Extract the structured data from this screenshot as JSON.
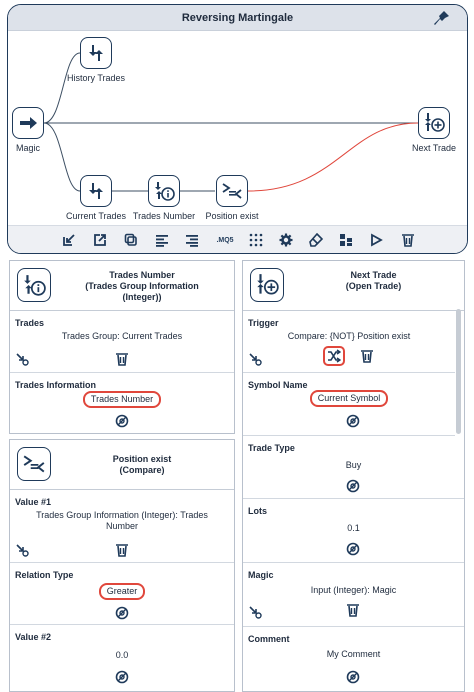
{
  "diagram": {
    "title": "Reversing Martingale",
    "nodes": [
      {
        "id": "history",
        "label": "History Trades",
        "icon": "history-trades-icon"
      },
      {
        "id": "magic",
        "label": "Magic",
        "icon": "input-arrow-icon"
      },
      {
        "id": "current",
        "label": "Current Trades",
        "icon": "current-trades-icon"
      },
      {
        "id": "number",
        "label": "Trades Number",
        "icon": "trades-info-icon"
      },
      {
        "id": "position",
        "label": "Position exist",
        "icon": "compare-icon"
      },
      {
        "id": "next",
        "label": "Next Trade",
        "icon": "open-trade-icon"
      }
    ],
    "toolbar": [
      "import-icon",
      "export-icon",
      "copy-icon",
      "align-left-icon",
      "align-right-icon",
      ".MQ5",
      "grid-icon",
      "settings-icon",
      "eraser-icon",
      "layout-icon",
      "run-icon",
      "delete-icon"
    ],
    "colors": {
      "link": "#3d4f63",
      "active_link": "#e0473c",
      "border": "#1f3a5a"
    }
  },
  "panels": {
    "trades_number": {
      "title": "Trades Number\n(Trades Group Information\n(Integer))",
      "fields": [
        {
          "label": "Trades",
          "value": "Trades Group: Current Trades"
        },
        {
          "label": "Trades Information",
          "value": "Trades Number"
        }
      ]
    },
    "position_exist": {
      "title": "Position exist\n(Compare)",
      "fields": [
        {
          "label": "Value #1",
          "value": "Trades Group Information (Integer): Trades Number"
        },
        {
          "label": "Relation Type",
          "value": "Greater"
        },
        {
          "label": "Value #2",
          "value": "0.0"
        }
      ]
    },
    "next_trade": {
      "title": "Next Trade\n(Open Trade)",
      "fields": [
        {
          "label": "Trigger",
          "value": "Compare: {NOT} Position exist"
        },
        {
          "label": "Symbol Name",
          "value": "Current Symbol"
        },
        {
          "label": "Trade Type",
          "value": "Buy"
        },
        {
          "label": "Lots",
          "value": "0.1"
        },
        {
          "label": "Magic",
          "value": "Input (Integer): Magic"
        },
        {
          "label": "Comment",
          "value": "My Comment"
        }
      ]
    }
  }
}
